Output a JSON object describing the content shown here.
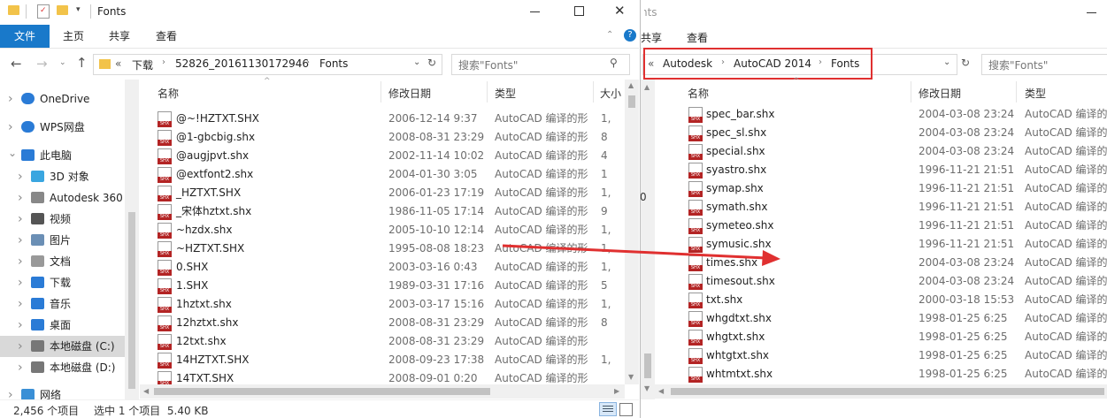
{
  "left": {
    "title": "Fonts",
    "ribbon": {
      "file": "文件",
      "home": "主页",
      "share": "共享",
      "view": "查看"
    },
    "address": {
      "prefix": "«",
      "seg1": "下载",
      "seg2": "52826_20161130172946",
      "seg3": "Fonts"
    },
    "search_placeholder": "搜索\"Fonts\"",
    "columns": {
      "name": "名称",
      "date": "修改日期",
      "type": "类型",
      "size": "大小"
    },
    "files": [
      {
        "name": "@~!HZTXT.SHX",
        "date": "2006-12-14 9:37",
        "type": "AutoCAD 编译的形",
        "size": "1,"
      },
      {
        "name": "@1-gbcbig.shx",
        "date": "2008-08-31 23:29",
        "type": "AutoCAD 编译的形",
        "size": "8"
      },
      {
        "name": "@augjpvt.shx",
        "date": "2002-11-14 10:02",
        "type": "AutoCAD 编译的形",
        "size": "4"
      },
      {
        "name": "@extfont2.shx",
        "date": "2004-01-30 3:05",
        "type": "AutoCAD 编译的形",
        "size": "1"
      },
      {
        "name": "_HZTXT.SHX",
        "date": "2006-01-23 17:19",
        "type": "AutoCAD 编译的形",
        "size": "1,"
      },
      {
        "name": "_宋体hztxt.shx",
        "date": "1986-11-05 17:14",
        "type": "AutoCAD 编译的形",
        "size": "9"
      },
      {
        "name": "~hzdx.shx",
        "date": "2005-10-10 12:14",
        "type": "AutoCAD 编译的形",
        "size": "1,"
      },
      {
        "name": "~HZTXT.SHX",
        "date": "1995-08-08 18:23",
        "type": "AutoCAD 编译的形",
        "size": "1,"
      },
      {
        "name": "0.SHX",
        "date": "2003-03-16 0:43",
        "type": "AutoCAD 编译的形",
        "size": "1,"
      },
      {
        "name": "1.SHX",
        "date": "1989-03-31 17:16",
        "type": "AutoCAD 编译的形",
        "size": "5"
      },
      {
        "name": "1hztxt.shx",
        "date": "2003-03-17 15:16",
        "type": "AutoCAD 编译的形",
        "size": "1,"
      },
      {
        "name": "12hztxt.shx",
        "date": "2008-08-31 23:29",
        "type": "AutoCAD 编译的形",
        "size": "8"
      },
      {
        "name": "12txt.shx",
        "date": "2008-08-31 23:29",
        "type": "AutoCAD 编译的形",
        "size": ""
      },
      {
        "name": "14HZTXT.SHX",
        "date": "2008-09-23 17:38",
        "type": "AutoCAD 编译的形",
        "size": "1,"
      },
      {
        "name": "14TXT.SHX",
        "date": "2008-09-01 0:20",
        "type": "AutoCAD 编译的形",
        "size": ""
      }
    ],
    "nav": [
      {
        "label": "OneDrive",
        "icon": "cloud-icon"
      },
      {
        "label": "WPS网盘",
        "icon": "wps-cloud-icon"
      },
      {
        "label": "此电脑",
        "icon": "computer-icon"
      },
      {
        "label": "3D 对象",
        "icon": "3d-objects-icon"
      },
      {
        "label": "Autodesk 360",
        "icon": "autodesk-icon"
      },
      {
        "label": "视频",
        "icon": "video-icon"
      },
      {
        "label": "图片",
        "icon": "pictures-icon"
      },
      {
        "label": "文档",
        "icon": "documents-icon"
      },
      {
        "label": "下载",
        "icon": "download-icon"
      },
      {
        "label": "音乐",
        "icon": "music-icon"
      },
      {
        "label": "桌面",
        "icon": "desktop-icon"
      },
      {
        "label": "本地磁盘 (C:)",
        "icon": "drive-icon"
      },
      {
        "label": "本地磁盘 (D:)",
        "icon": "drive-icon"
      },
      {
        "label": "网络",
        "icon": "network-icon"
      }
    ],
    "status": {
      "count": "2,456 个项目",
      "selected": "选中 1 个项目  5.40 KB"
    },
    "side_digit": "0"
  },
  "right": {
    "title_partial": "nts",
    "ribbon": {
      "share": "共享",
      "view": "查看"
    },
    "address": {
      "prefix": "«",
      "seg1": "Autodesk",
      "seg2": "AutoCAD 2014",
      "seg3": "Fonts"
    },
    "search_placeholder": "搜索\"Fonts\"",
    "columns": {
      "name": "名称",
      "date": "修改日期",
      "type": "类型"
    },
    "files": [
      {
        "name": "spec_bar.shx",
        "date": "2004-03-08 23:24",
        "type": "AutoCAD 编译的形"
      },
      {
        "name": "spec_sl.shx",
        "date": "2004-03-08 23:24",
        "type": "AutoCAD 编译的形"
      },
      {
        "name": "special.shx",
        "date": "2004-03-08 23:24",
        "type": "AutoCAD 编译的形"
      },
      {
        "name": "syastro.shx",
        "date": "1996-11-21 21:51",
        "type": "AutoCAD 编译的形"
      },
      {
        "name": "symap.shx",
        "date": "1996-11-21 21:51",
        "type": "AutoCAD 编译的形"
      },
      {
        "name": "symath.shx",
        "date": "1996-11-21 21:51",
        "type": "AutoCAD 编译的形"
      },
      {
        "name": "symeteo.shx",
        "date": "1996-11-21 21:51",
        "type": "AutoCAD 编译的形"
      },
      {
        "name": "symusic.shx",
        "date": "1996-11-21 21:51",
        "type": "AutoCAD 编译的形"
      },
      {
        "name": "times.shx",
        "date": "2004-03-08 23:24",
        "type": "AutoCAD 编译的形"
      },
      {
        "name": "timesout.shx",
        "date": "2004-03-08 23:24",
        "type": "AutoCAD 编译的形"
      },
      {
        "name": "txt.shx",
        "date": "2000-03-18 15:53",
        "type": "AutoCAD 编译的形"
      },
      {
        "name": "whgdtxt.shx",
        "date": "1998-01-25 6:25",
        "type": "AutoCAD 编译的形"
      },
      {
        "name": "whgtxt.shx",
        "date": "1998-01-25 6:25",
        "type": "AutoCAD 编译的形"
      },
      {
        "name": "whtgtxt.shx",
        "date": "1998-01-25 6:25",
        "type": "AutoCAD 编译的形"
      },
      {
        "name": "whtmtxt.shx",
        "date": "1998-01-25 6:25",
        "type": "AutoCAD 编译的形"
      }
    ]
  },
  "icons": {
    "file_badge": "SHX"
  },
  "colors": {
    "accent": "#1979ca",
    "annotation_red": "#e03030"
  }
}
